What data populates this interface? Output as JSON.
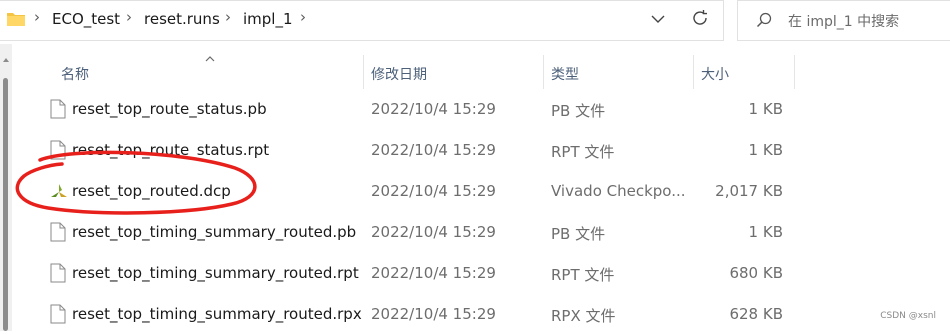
{
  "address_bar": {
    "breadcrumbs": [
      "ECO_test",
      "reset.runs",
      "impl_1"
    ]
  },
  "search": {
    "placeholder": "在 impl_1 中搜索"
  },
  "columns": {
    "name": "名称",
    "date": "修改日期",
    "type": "类型",
    "size": "大小"
  },
  "files": [
    {
      "name": "reset_top_route_status.pb",
      "date": "2022/10/4 15:29",
      "type": "PB 文件",
      "size": "1 KB",
      "icon": "file-icon"
    },
    {
      "name": "reset_top_route_status.rpt",
      "date": "2022/10/4 15:29",
      "type": "RPT 文件",
      "size": "1 KB",
      "icon": "file-icon"
    },
    {
      "name": "reset_top_routed.dcp",
      "date": "2022/10/4 15:29",
      "type": "Vivado Checkpo...",
      "size": "2,017 KB",
      "icon": "vivado-icon",
      "circled": true
    },
    {
      "name": "reset_top_timing_summary_routed.pb",
      "date": "2022/10/4 15:29",
      "type": "PB 文件",
      "size": "1 KB",
      "icon": "file-icon"
    },
    {
      "name": "reset_top_timing_summary_routed.rpt",
      "date": "2022/10/4 15:29",
      "type": "RPT 文件",
      "size": "680 KB",
      "icon": "file-icon"
    },
    {
      "name": "reset_top_timing_summary_routed.rpx",
      "date": "2022/10/4 15:29",
      "type": "RPX 文件",
      "size": "628 KB",
      "icon": "file-icon"
    }
  ],
  "annotation_color": "#e8201c",
  "watermark": "CSDN @xsnl"
}
